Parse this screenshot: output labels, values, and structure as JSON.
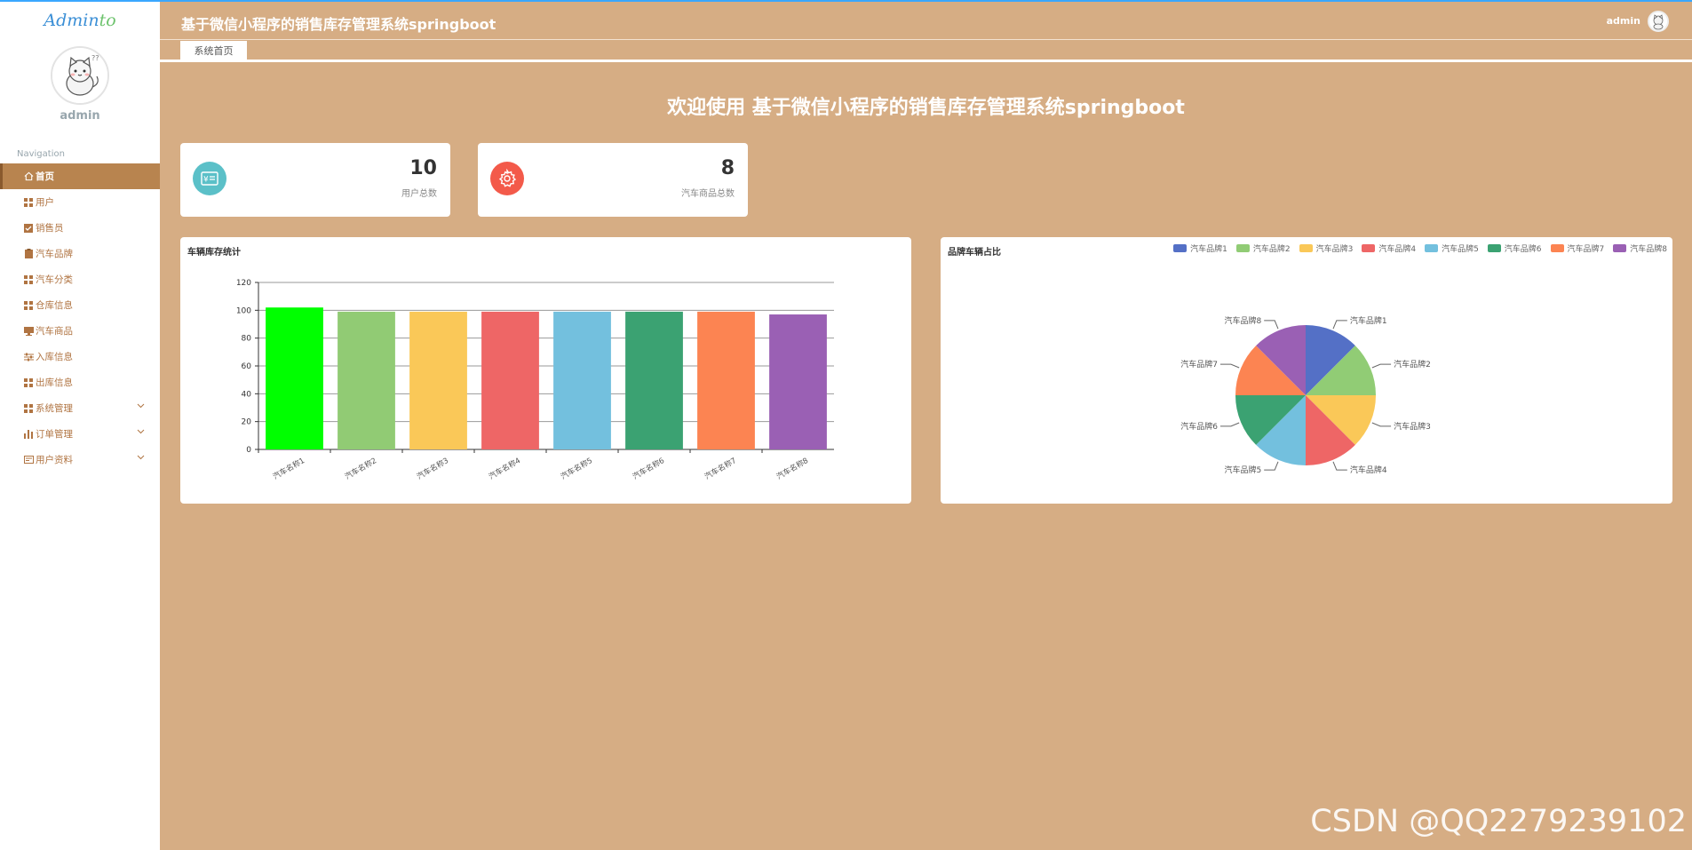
{
  "sidebar": {
    "logo": {
      "main": "Admin",
      "accent": "to"
    },
    "username": "admin",
    "nav_title": "Navigation",
    "items": [
      {
        "label": "首页",
        "icon": "home-icon",
        "active": true,
        "expandable": false
      },
      {
        "label": "用户",
        "icon": "grid-icon",
        "active": false,
        "expandable": false
      },
      {
        "label": "销售员",
        "icon": "checkbox-icon",
        "active": false,
        "expandable": false
      },
      {
        "label": "汽车品牌",
        "icon": "clipboard-icon",
        "active": false,
        "expandable": false
      },
      {
        "label": "汽车分类",
        "icon": "grid-icon",
        "active": false,
        "expandable": false
      },
      {
        "label": "仓库信息",
        "icon": "grid-icon",
        "active": false,
        "expandable": false
      },
      {
        "label": "汽车商品",
        "icon": "monitor-icon",
        "active": false,
        "expandable": false
      },
      {
        "label": "入库信息",
        "icon": "sliders-icon",
        "active": false,
        "expandable": false
      },
      {
        "label": "出库信息",
        "icon": "grid-icon",
        "active": false,
        "expandable": false
      },
      {
        "label": "系统管理",
        "icon": "grid-icon",
        "active": false,
        "expandable": true
      },
      {
        "label": "订单管理",
        "icon": "bar-chart-icon",
        "active": false,
        "expandable": true
      },
      {
        "label": "用户资料",
        "icon": "id-card-icon",
        "active": false,
        "expandable": true
      }
    ]
  },
  "header": {
    "title": "基于微信小程序的销售库存管理系统springboot",
    "username": "admin"
  },
  "tabs": [
    {
      "label": "系统首页"
    }
  ],
  "welcome": "欢迎使用 基于微信小程序的销售库存管理系统springboot",
  "stats": [
    {
      "value": "10",
      "label": "用户总数",
      "icon": "yen-card-icon",
      "color": "#5bc0c8"
    },
    {
      "value": "8",
      "label": "汽车商品总数",
      "icon": "gear-icon",
      "color": "#f35a4a"
    }
  ],
  "colors": {
    "sidebar_active": "#b8844f",
    "nav_text": "#b07442",
    "background": "#d6ad84"
  },
  "chart_data": [
    {
      "type": "bar",
      "title": "车辆库存统计",
      "categories": [
        "汽车名称1",
        "汽车名称2",
        "汽车名称3",
        "汽车名称4",
        "汽车名称5",
        "汽车名称6",
        "汽车名称7",
        "汽车名称8"
      ],
      "values": [
        102,
        99,
        99,
        99,
        99,
        99,
        99,
        97
      ],
      "colors": [
        "#00ff00",
        "#91cb74",
        "#fac858",
        "#ee6666",
        "#73c0de",
        "#3ba272",
        "#fc8452",
        "#9a60b4"
      ],
      "ylim": [
        0,
        120
      ],
      "yticks": [
        "0",
        "20",
        "40",
        "60",
        "80",
        "100",
        "120"
      ],
      "grid": true
    },
    {
      "type": "pie",
      "title": "品牌车辆占比",
      "categories": [
        "汽车品牌1",
        "汽车品牌2",
        "汽车品牌3",
        "汽车品牌4",
        "汽车品牌5",
        "汽车品牌6",
        "汽车品牌7",
        "汽车品牌8"
      ],
      "values": [
        1,
        1,
        1,
        1,
        1,
        1,
        1,
        1
      ],
      "colors": [
        "#5470c6",
        "#91cc75",
        "#fac858",
        "#ee6666",
        "#73c0de",
        "#3ba272",
        "#fc8452",
        "#9a60b4"
      ],
      "legend": "top-right"
    }
  ],
  "watermark": "CSDN @QQ2279239102"
}
